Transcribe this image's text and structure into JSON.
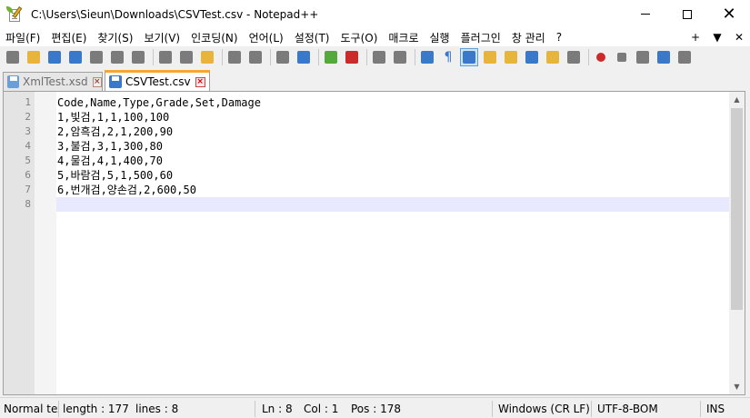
{
  "window": {
    "title": "C:\\Users\\Sieun\\Downloads\\CSVTest.csv - Notepad++",
    "minimize_label": "",
    "maximize_label": "",
    "close_label": "✕"
  },
  "menu": {
    "items": [
      "파일(F)",
      "편집(E)",
      "찾기(S)",
      "보기(V)",
      "인코딩(N)",
      "언어(L)",
      "설정(T)",
      "도구(O)",
      "매크로",
      "실행",
      "플러그인",
      "창 관리",
      "?"
    ],
    "right": [
      "+",
      "▼",
      "✕"
    ]
  },
  "toolbar": {
    "icons": [
      "new-file",
      "open-file",
      "save",
      "save-all",
      "close",
      "close-all",
      "print",
      "cut",
      "copy",
      "paste",
      "undo",
      "redo",
      "find",
      "replace",
      "zoom-in",
      "zoom-out",
      "sync-vertical",
      "sync-horizontal",
      "word-wrap",
      "show-all-chars",
      "indent-guide",
      "user-defined-lang",
      "doc-map",
      "function-list",
      "folder-workspace",
      "monitoring",
      "record-macro",
      "stop-record",
      "play-macro",
      "run-macro-multiple",
      "save-macro"
    ],
    "colors": {
      "blue": "#3a78c9",
      "green": "#55a83b",
      "red": "#cc2b2b",
      "yellow": "#e7b53a",
      "gray": "#7b7b7b"
    }
  },
  "tabs": [
    {
      "label": "XmlTest.xsd",
      "state": "inactive",
      "disk_color": "#6a9ed8"
    },
    {
      "label": "CSVTest.csv",
      "state": "active",
      "disk_color": "#3b78c8"
    }
  ],
  "editor": {
    "line_numbers": [
      "1",
      "2",
      "3",
      "4",
      "5",
      "6",
      "7",
      "8"
    ],
    "lines": [
      "Code,Name,Type,Grade,Set,Damage",
      "1,빛검,1,1,100,100",
      "2,암흑검,2,1,200,90",
      "3,불검,3,1,300,80",
      "4,물검,4,1,400,70",
      "5,바람검,5,1,500,60",
      "6,번개검,양손검,2,600,50",
      ""
    ],
    "current_line_color": "#e8e8ff"
  },
  "status": {
    "type": "Normal tex",
    "length": "length : 177",
    "lines": "lines : 8",
    "ln": "Ln : 8",
    "col": "Col : 1",
    "pos": "Pos : 178",
    "eol": "Windows (CR LF)",
    "encoding": "UTF-8-BOM",
    "mode": "INS"
  }
}
